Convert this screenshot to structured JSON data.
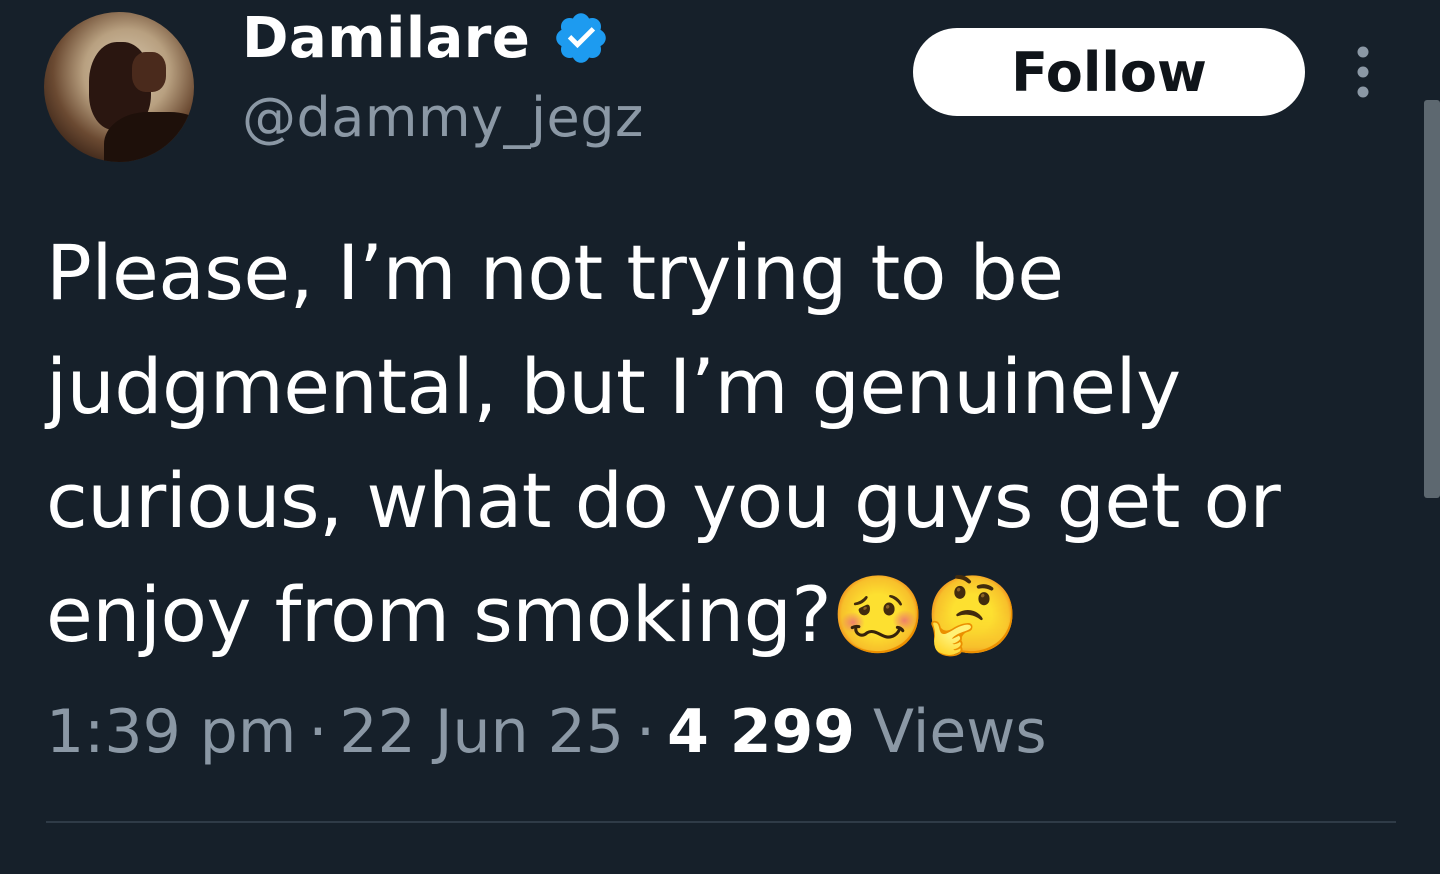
{
  "author": {
    "display_name": "Damilare",
    "handle": "@dammy_jegz",
    "verified": true,
    "verified_color": "#1d9bf0"
  },
  "actions": {
    "follow_label": "Follow",
    "more_icon": "more-vertical-icon"
  },
  "tweet": {
    "text": "Please, I’m not trying to be\njudgmental, but I’m genuinely\ncurious, what do you guys get or\nenjoy from smoking?🥴🤔"
  },
  "meta": {
    "time": "1:39 pm",
    "separator": "·",
    "date": "22 Jun 25",
    "views_count": "4 299",
    "views_label": "Views"
  },
  "colors": {
    "background": "#16202a",
    "text_primary": "#ffffff",
    "text_secondary": "#8b98a5",
    "divider": "#2f3b47"
  }
}
